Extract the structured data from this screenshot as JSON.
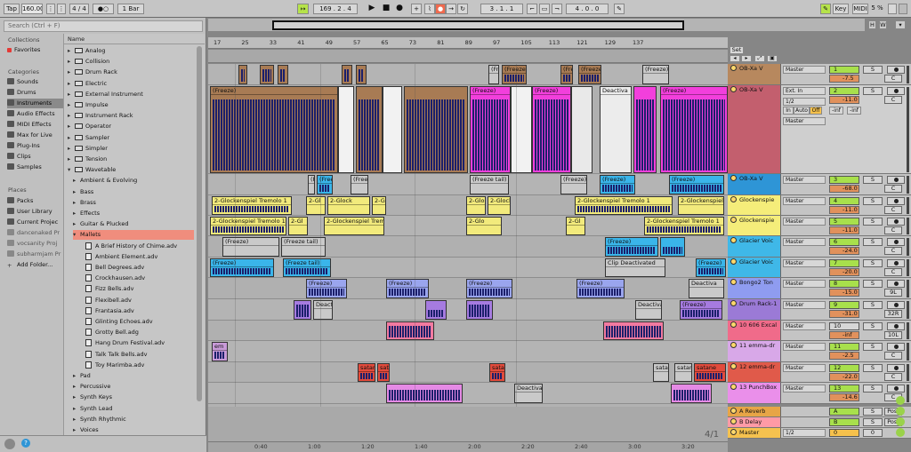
{
  "transport": {
    "tap": "Tap",
    "tempo": "160.00",
    "sig": "4 / 4",
    "metro": "●○",
    "quant": "1 Bar",
    "position": "169 .  2 .  4",
    "loop_start": "3 .  1 .  1",
    "loop_len": "4 .  0 .  0",
    "key": "Key",
    "midi": "MIDI",
    "cpu": "5 %",
    "h": "H",
    "w": "W"
  },
  "browser": {
    "search_placeholder": "Search (Ctrl + F)",
    "collections_label": "Collections",
    "favorites": "Favorites",
    "categories_label": "Categories",
    "categories": [
      "Sounds",
      "Drums",
      "Instruments",
      "Audio Effects",
      "MIDI Effects",
      "Max for Live",
      "Plug-Ins",
      "Clips",
      "Samples"
    ],
    "places_label": "Places",
    "places": [
      "Packs",
      "User Library",
      "Current Projec",
      "dancenaked Pr",
      "vocsanity Proj",
      "subharmjam Pr",
      "Add Folder..."
    ],
    "name_header": "Name",
    "items": [
      "Analog",
      "Collision",
      "Drum Rack",
      "Electric",
      "External Instrument",
      "Impulse",
      "Instrument Rack",
      "Operator",
      "Sampler",
      "Simpler",
      "Tension",
      "Wavetable",
      "Ambient & Evolving",
      "Bass",
      "Brass",
      "Effects",
      "Guitar & Plucked",
      "Mallets",
      "A Brief History of Chime.adv",
      "Ambient Element.adv",
      "Bell Degrees.adv",
      "Crockhausen.adv",
      "Fizz Bells.adv",
      "Flexibell.adv",
      "Frantasia.adv",
      "Glinting Echoes.adv",
      "Grotty Bell.adg",
      "Hang Drum Festival.adv",
      "Talk Talk Bells.adv",
      "Toy Marimba.adv",
      "Pad",
      "Percussive",
      "Synth Keys",
      "Synth Lead",
      "Synth Rhythmic",
      "Voices"
    ]
  },
  "ruler": [
    "17",
    "25",
    "33",
    "41",
    "49",
    "57",
    "65",
    "73",
    "81",
    "89",
    "97",
    "105",
    "113",
    "121",
    "129",
    "137"
  ],
  "timeline": [
    "0:40",
    "1:00",
    "1:20",
    "1:40",
    "2:00",
    "2:20",
    "2:40",
    "3:00",
    "3:20"
  ],
  "zoom_label": "4/1",
  "set_label": "Set",
  "clip_labels": {
    "freeze": "(Freeze)",
    "freeze_tail": "(Freeze tail)",
    "clip_deactivated": "Clip Deactivated",
    "deactivated": "Deactivated",
    "deactiva": "Deactiva",
    "gl_tremolo": "2-Glockenspiel Tremolo 1",
    "gl_short": "2-Gl",
    "gl_c": "2-Glo",
    "gl_ock": "2-Glock",
    "satane": "satane",
    "satan": "sata",
    "deactiva2": "Deactiva",
    "em": "em",
    "freeze_ta": "(Fre",
    "freeze_e": "(Free"
  },
  "tracks": [
    {
      "name": "OB-Xa V",
      "num": "1",
      "vol": "-7.5",
      "pan": "C",
      "io": "Master",
      "color": "#b7885e"
    },
    {
      "name": "OB-Xa V",
      "num": "2",
      "vol": "-11.0",
      "pan": "C",
      "io": "Ext. In",
      "io2": "1/2",
      "io3": "Master",
      "in_label": "In",
      "auto_label": "Auto",
      "off_label": "Off",
      "send_a": "-inf",
      "send_b": "-inf",
      "color": "#c35f6e"
    },
    {
      "name": "OB-Xa V",
      "num": "3",
      "vol": "-68.0",
      "pan": "C",
      "io": "Master",
      "color": "#2e95d6"
    },
    {
      "name": "Glockenspie",
      "num": "4",
      "vol": "-11.0",
      "pan": "C",
      "io": "Master",
      "color": "#f5ed7a"
    },
    {
      "name": "Glockenspie",
      "num": "5",
      "vol": "-11.0",
      "pan": "C",
      "io": "Master",
      "color": "#f5ed7a"
    },
    {
      "name": "Glacier Voic",
      "num": "6",
      "vol": "-24.0",
      "pan": "C",
      "io": "Master",
      "color": "#3fb8e8"
    },
    {
      "name": "Glacier Voic",
      "num": "7",
      "vol": "-20.0",
      "pan": "C",
      "io": "Master",
      "color": "#3fb8e8"
    },
    {
      "name": "Bongo2 Ton",
      "num": "8",
      "vol": "-15.0",
      "pan": "9L",
      "io": "Master",
      "color": "#8f9cf0"
    },
    {
      "name": "Drum Rack-1",
      "num": "9",
      "vol": "-31.0",
      "pan": "32R",
      "io": "Master",
      "color": "#9b7ad6"
    },
    {
      "name": "10 606 Excal",
      "num": "10",
      "vol": "-inf",
      "pan": "10L",
      "io": "Master",
      "color": "#f06b8a"
    },
    {
      "name": "11 emma-dr",
      "num": "11",
      "vol": "-2.5",
      "pan": "C",
      "io": "Master",
      "color": "#d8a8e8"
    },
    {
      "name": "12 emma-dr",
      "num": "12",
      "vol": "-22.0",
      "pan": "C",
      "io": "Master",
      "color": "#e05a4a"
    },
    {
      "name": "13 PunchBox",
      "num": "13",
      "vol": "-14.6",
      "pan": "C",
      "io": "Master",
      "color": "#ea8fea"
    }
  ],
  "returns": [
    {
      "name": "A Reverb",
      "num": "A",
      "label": "Post",
      "color": "#e7a546"
    },
    {
      "name": "B Delay",
      "num": "B",
      "label": "Post",
      "color": "#ff9aa6"
    }
  ],
  "master": {
    "name": "Master",
    "io": "1/2",
    "num": "0",
    "color": "#f5c24f"
  }
}
